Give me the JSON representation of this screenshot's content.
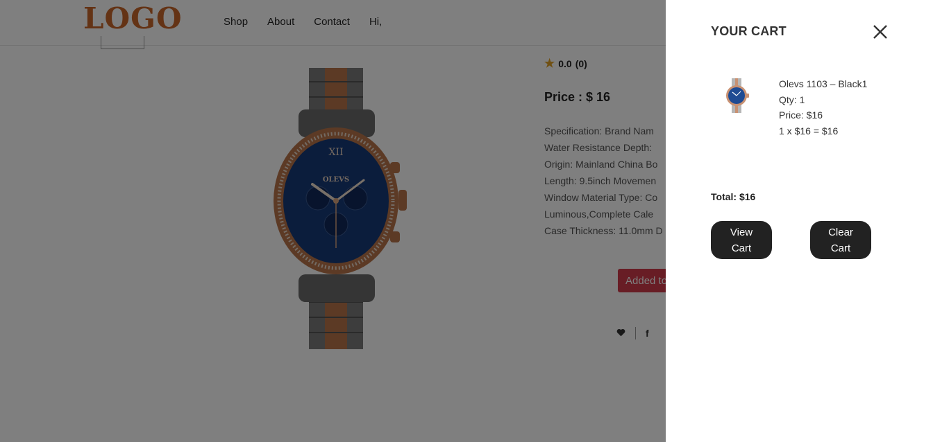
{
  "colors": {
    "logo": "#c8662a",
    "star": "#e0a126",
    "added_button": "#d13a4b",
    "button_dark": "#222222"
  },
  "header": {
    "logo": "LOGO",
    "nav": [
      "Shop",
      "About",
      "Contact",
      "Hi,"
    ]
  },
  "product": {
    "rating": {
      "icon": "star-icon",
      "value": "0.0",
      "count": "(0)"
    },
    "price": "Price : $ 16",
    "spec_lines": [
      "Specification: Brand Nam",
      "Water Resistance Depth:",
      "Origin: Mainland China Bo",
      "Length: 9.5inch Movemen",
      "Window Material Type: Co",
      "Luminous,Complete Cale",
      "Case Thickness: 11.0mm D"
    ],
    "added_button": "Added to",
    "share_icons": [
      "heart-icon",
      "facebook-icon"
    ],
    "watch_brand": "OLEVS"
  },
  "cart": {
    "title": "YOUR CART",
    "close_icon": "close-icon",
    "item": {
      "name": "Olevs 1103 – Black1",
      "qty": "Qty: 1",
      "price": "Price: $16",
      "line_total": "1 x $16 = $16"
    },
    "total": "Total: $16",
    "view_cart": [
      "View",
      "Cart"
    ],
    "clear_cart": [
      "Clear",
      "Cart"
    ]
  }
}
